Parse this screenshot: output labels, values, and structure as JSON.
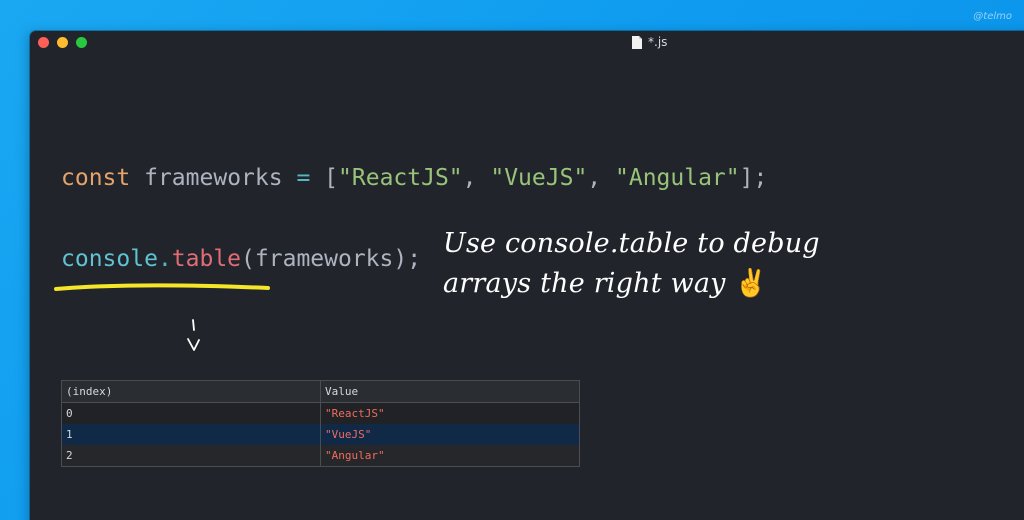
{
  "watermark": "@telmo",
  "window": {
    "title": "*.js",
    "traffic_lights": [
      "close",
      "minimize",
      "maximize"
    ]
  },
  "code": {
    "line1": {
      "keyword": "const",
      "identifier": "frameworks",
      "operator": "=",
      "open_bracket": "[",
      "items": [
        "\"ReactJS\"",
        "\"VueJS\"",
        "\"Angular\""
      ],
      "separator": ", ",
      "close": "];"
    },
    "line2": {
      "object": "console",
      "dot": ".",
      "method": "table",
      "open_paren": "(",
      "argument": "frameworks",
      "close": ");"
    }
  },
  "annotation": {
    "line1": "Use console.table to debug",
    "line2": "arrays the right way",
    "emoji": "✌️"
  },
  "console_table": {
    "headers": [
      "(index)",
      "Value"
    ],
    "rows": [
      {
        "index": "0",
        "value": "\"ReactJS\""
      },
      {
        "index": "1",
        "value": "\"VueJS\""
      },
      {
        "index": "2",
        "value": "\"Angular\""
      }
    ]
  },
  "colors": {
    "background": "#1aa8f2",
    "editor_bg": "#21252b",
    "keyword": "#e5a36b",
    "string": "#98c379",
    "object": "#5fc3d3",
    "method": "#e06c75",
    "highlight_underline": "#f5e62a",
    "table_value": "#f16b5e",
    "selected_row": "#0f2946"
  }
}
